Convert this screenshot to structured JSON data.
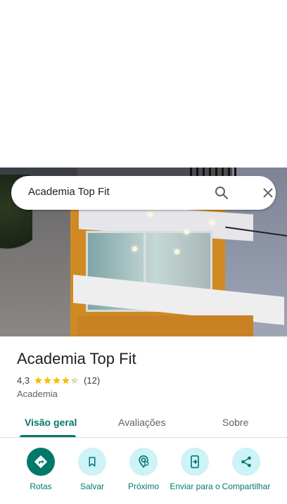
{
  "search": {
    "query": "Academia Top Fit"
  },
  "place": {
    "title": "Academia Top Fit",
    "rating": "4,3",
    "stars": 4.3,
    "review_count": "(12)",
    "category": "Academia"
  },
  "tabs": [
    {
      "label": "Visão geral",
      "active": true
    },
    {
      "label": "Avaliações",
      "active": false
    },
    {
      "label": "Sobre",
      "active": false
    }
  ],
  "actions": [
    {
      "label": "Rotas",
      "icon": "directions-icon"
    },
    {
      "label": "Salvar",
      "icon": "bookmark-icon"
    },
    {
      "label": "Próximo",
      "icon": "nearby-icon"
    },
    {
      "label": "Enviar para o",
      "icon": "send-to-phone-icon"
    },
    {
      "label": "Compartilhar",
      "icon": "share-icon"
    }
  ],
  "colors": {
    "accent": "#00796b",
    "action_bg": "#cdf2f7",
    "star": "#fbbc04"
  }
}
